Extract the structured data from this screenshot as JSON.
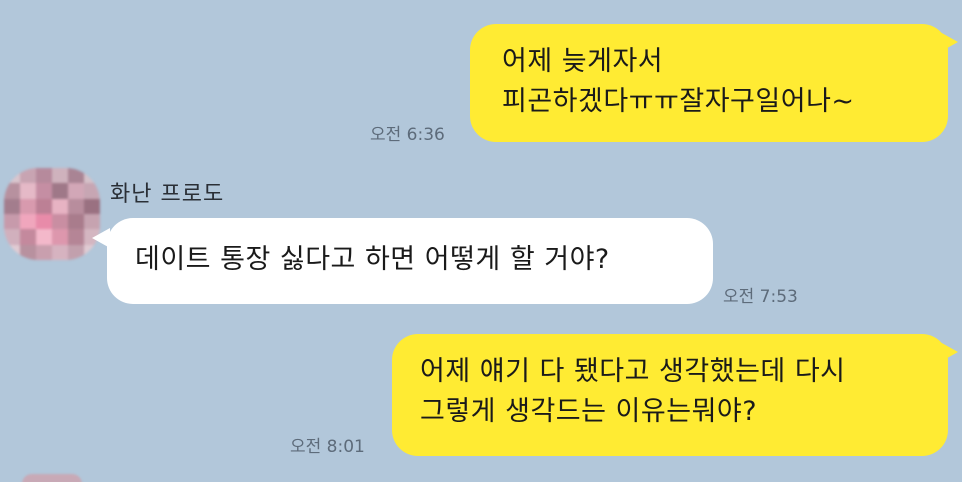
{
  "messages": [
    {
      "direction": "outgoing",
      "lines": [
        "어제 늦게자서",
        "피곤하겠다ㅠㅠ잘자구일어나~"
      ],
      "time": "오전 6:36"
    },
    {
      "direction": "incoming",
      "sender": "화난 프로도",
      "lines": [
        "데이트 통장 싫다고 하면 어떻게 할 거야?"
      ],
      "time": "오전 7:53"
    },
    {
      "direction": "outgoing",
      "lines": [
        "어제 얘기 다 됐다고 생각했는데 다시",
        "그렇게 생각드는 이유는뭐야?"
      ],
      "time": "오전 8:01"
    }
  ],
  "colors": {
    "background": "#b2c7da",
    "outgoing_bubble": "#ffeb33",
    "incoming_bubble": "#ffffff",
    "timestamp": "#5d6b7a"
  },
  "avatar": {
    "icon": "blurred-profile-avatar-icon"
  }
}
